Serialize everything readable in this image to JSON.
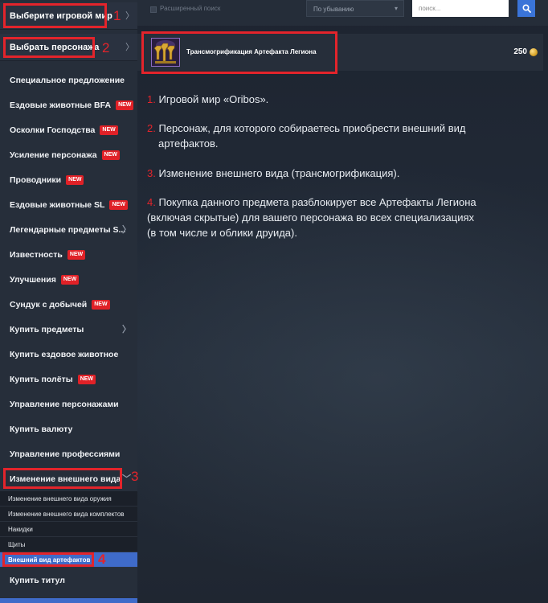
{
  "sidebar": {
    "world_selector": {
      "label": "Выберите игровой мир",
      "number": "1"
    },
    "character_selector": {
      "label": "Выбрать персонажа",
      "number": "2"
    },
    "items": [
      {
        "label": "Специальное предложение",
        "badge": ""
      },
      {
        "label": "Ездовые животные BFA",
        "badge": "NEW"
      },
      {
        "label": "Осколки Господства",
        "badge": "NEW"
      },
      {
        "label": "Усиление персонажа",
        "badge": "NEW"
      },
      {
        "label": "Проводники",
        "badge": "NEW"
      },
      {
        "label": "Ездовые животные SL",
        "badge": "NEW"
      },
      {
        "label": "Легендарные предметы S...",
        "badge": ""
      },
      {
        "label": "Известность",
        "badge": "NEW"
      },
      {
        "label": "Улучшения",
        "badge": "NEW"
      },
      {
        "label": "Сундук с добычей",
        "badge": "NEW"
      },
      {
        "label": "Купить предметы",
        "badge": ""
      },
      {
        "label": "Купить ездовое животное",
        "badge": ""
      },
      {
        "label": "Купить полёты",
        "badge": "NEW"
      },
      {
        "label": "Управление персонажами",
        "badge": ""
      },
      {
        "label": "Купить валюту",
        "badge": ""
      },
      {
        "label": "Управление профессиями",
        "badge": ""
      },
      {
        "label": "Изменение внешнего вида",
        "badge": "",
        "number": "3"
      }
    ],
    "subitems": [
      {
        "label": "Изменение внешнего вида оружия"
      },
      {
        "label": "Изменение внешнего вида комплектов"
      },
      {
        "label": "Накидки"
      },
      {
        "label": "Щиты"
      },
      {
        "label": "Внешний вид артефактов",
        "number": "4",
        "active": true
      }
    ],
    "last_item": {
      "label": "Купить титул"
    }
  },
  "topbar": {
    "extended_search_label": "Расширенный поиск",
    "sort_value": "По убыванию",
    "search_placeholder": "поиск..."
  },
  "product": {
    "title": "Трансмогрификация Артефакта Легиона",
    "price": "250"
  },
  "notes": [
    {
      "num": "1.",
      "text": "Игровой мир «Oribos»."
    },
    {
      "num": "2.",
      "line1": "Персонаж, для которого собираетесь приобрести внешний вид",
      "line2": "артефактов."
    },
    {
      "num": "3.",
      "text": "Изменение внешнего вида (трансмогрификация)."
    },
    {
      "num": "4.",
      "line1": "Покупка данного предмета разблокирует все Артефакты Легиона",
      "line2": "(включая скрытые) для вашего персонажа во всех специализациях",
      "line3": "(в том числе и облики друида)."
    }
  ],
  "colors": {
    "annotation_red": "#e3242b",
    "accent_blue": "#3a74d8",
    "badge_red": "#e02127"
  }
}
